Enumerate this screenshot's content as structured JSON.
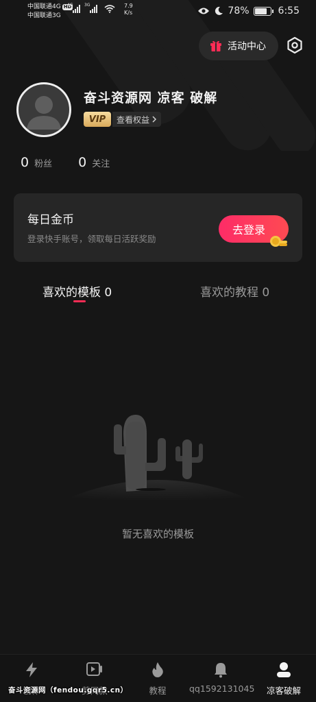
{
  "status_bar": {
    "carrier_1": "中国联通4G",
    "hd": "HD",
    "carrier_2": "中国联通3G",
    "sig1_tag": "4G",
    "sig2_tag": "3G",
    "net_speed_value": "7.9",
    "net_speed_unit": "K/s",
    "battery": "78%",
    "battery_level": 0.78,
    "time": "6:55"
  },
  "header": {
    "activity_center": "活动中心"
  },
  "profile": {
    "username": "奋斗资源网 凉客 破解",
    "vip": "VIP",
    "view_rights": "查看权益",
    "fans_count": "0",
    "fans_label": "粉丝",
    "following_count": "0",
    "following_label": "关注"
  },
  "coin_card": {
    "title": "每日金币",
    "desc": "登录快手账号，领取每日活跃奖励",
    "login_button": "去登录"
  },
  "tabs": [
    {
      "label": "喜欢的模板 0",
      "active": true
    },
    {
      "label": "喜欢的教程 0",
      "active": false
    }
  ],
  "empty_state": {
    "text": "暂无喜欢的模板"
  },
  "tabbar": {
    "items": [
      {
        "label": "创作",
        "icon": "lightning-icon"
      },
      {
        "label": "剪同款",
        "icon": "video-play-icon"
      },
      {
        "label": "教程",
        "icon": "flame-icon"
      },
      {
        "label": "qq1592131045",
        "icon": "bell-icon"
      },
      {
        "label": "凉客破解",
        "icon": "person-icon",
        "active": true
      }
    ]
  },
  "watermark": "奋斗资源网（fendou.gqr5.cn）",
  "colors": {
    "background": "#161616",
    "accent": "#fe2c55",
    "card": "#262626"
  }
}
